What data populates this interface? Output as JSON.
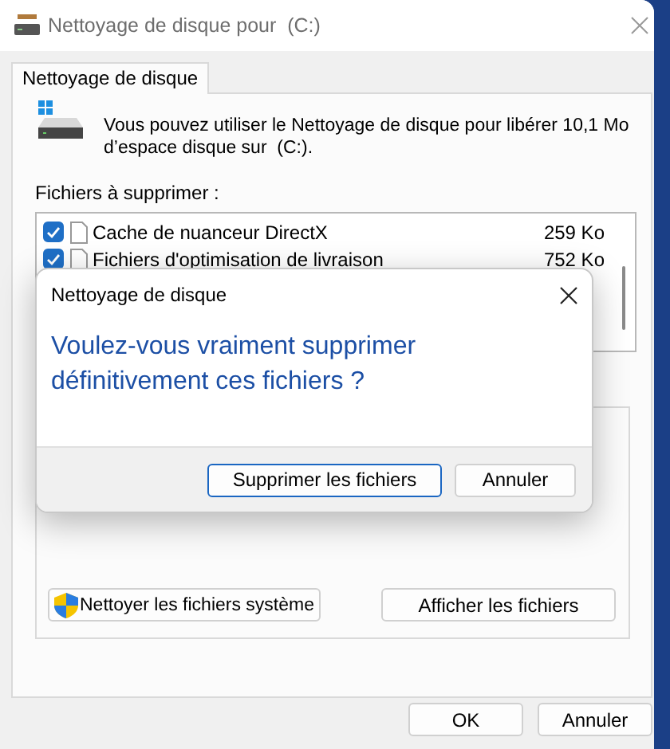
{
  "window": {
    "title": "Nettoyage de disque pour  (C:)"
  },
  "tabs": [
    {
      "label": "Nettoyage de disque",
      "selected": true
    }
  ],
  "description": "Vous pouvez utiliser le Nettoyage de disque pour libérer 10,1 Mo d’espace disque sur  (C:).",
  "files_label": "Fichiers à supprimer :",
  "files": [
    {
      "name": "Cache de nuanceur DirectX",
      "size": "259 Ko",
      "checked": true
    },
    {
      "name": "Fichiers d'optimisation de livraison",
      "size": "752 Ko",
      "checked": true
    }
  ],
  "panel_buttons": [
    {
      "label": "Nettoyer les fichiers système",
      "kind": "shield"
    },
    {
      "label": "Afficher les fichiers",
      "kind": "plain"
    }
  ],
  "buttons": [
    {
      "label": "OK"
    },
    {
      "label": "Annuler"
    }
  ],
  "confirm_dialog": {
    "title": "Nettoyage de disque",
    "message": "Voulez-vous vraiment supprimer définitivement ces fichiers ?",
    "buttons": [
      {
        "label": "Supprimer les fichiers",
        "default": true
      },
      {
        "label": "Annuler",
        "default": false
      }
    ]
  }
}
